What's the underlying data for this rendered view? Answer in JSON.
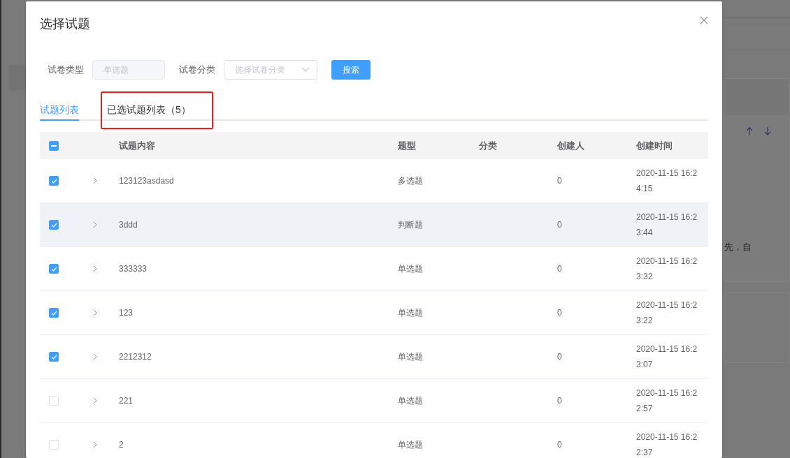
{
  "background": {
    "panel_text": "先，自"
  },
  "dialog": {
    "title": "选择试题",
    "filters": [
      {
        "kind": "input",
        "label": "试卷类型",
        "placeholder": "单选题",
        "disabled": true
      },
      {
        "kind": "select",
        "label": "试卷分类",
        "placeholder": "选择试卷分类"
      }
    ],
    "search_button": "搜索",
    "tabs": [
      {
        "label": "试题列表",
        "selected": true,
        "annotated": false
      },
      {
        "label": "已选试题列表（5）",
        "selected": false,
        "annotated": true
      }
    ],
    "table": {
      "select_all_partial": true,
      "columns": [
        "试题内容",
        "题型",
        "分类",
        "创建人",
        "创建时间"
      ],
      "rows": [
        {
          "checked": true,
          "hovered": false,
          "content": "123123asdasd",
          "type": "多选题",
          "creator": "0",
          "created": "2020-11-15 16:24:15"
        },
        {
          "checked": true,
          "hovered": true,
          "content": "3ddd",
          "type": "判断题",
          "creator": "0",
          "created": "2020-11-15 16:23:44"
        },
        {
          "checked": true,
          "hovered": false,
          "content": "333333",
          "type": "单选题",
          "creator": "0",
          "created": "2020-11-15 16:23:32"
        },
        {
          "checked": true,
          "hovered": false,
          "content": "123",
          "type": "单选题",
          "creator": "0",
          "created": "2020-11-15 16:23:22"
        },
        {
          "checked": true,
          "hovered": false,
          "content": "2212312",
          "type": "单选题",
          "creator": "0",
          "created": "2020-11-15 16:23:07"
        },
        {
          "checked": false,
          "hovered": false,
          "content": "221",
          "type": "单选题",
          "creator": "0",
          "created": "2020-11-15 16:22:57"
        },
        {
          "checked": false,
          "hovered": false,
          "content": "2",
          "type": "单选题",
          "creator": "0",
          "created": "2020-11-15 16:22:37"
        }
      ]
    }
  }
}
